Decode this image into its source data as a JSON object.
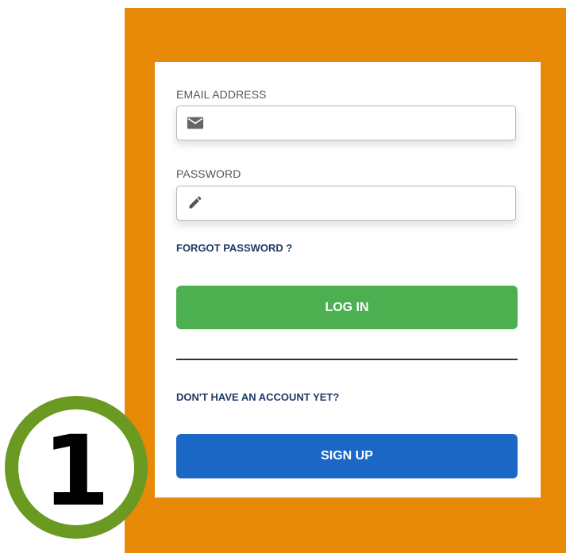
{
  "login_form": {
    "email_label": "EMAIL ADDRESS",
    "email_value": "",
    "email_icon": "envelope-icon",
    "password_label": "PASSWORD",
    "password_value": "",
    "password_icon": "pencil-icon",
    "forgot_link": "FORGOT PASSWORD ?",
    "login_button": "LOG IN",
    "no_account_text": "DON'T HAVE AN ACCOUNT YET?",
    "signup_button": "SIGN UP"
  },
  "annotation": {
    "step_number": "1"
  },
  "colors": {
    "frame": "#e68a08",
    "login_button": "#4caf50",
    "signup_button": "#1b67c6",
    "link": "#1f3a66",
    "badge_ring": "#6b9a22"
  }
}
